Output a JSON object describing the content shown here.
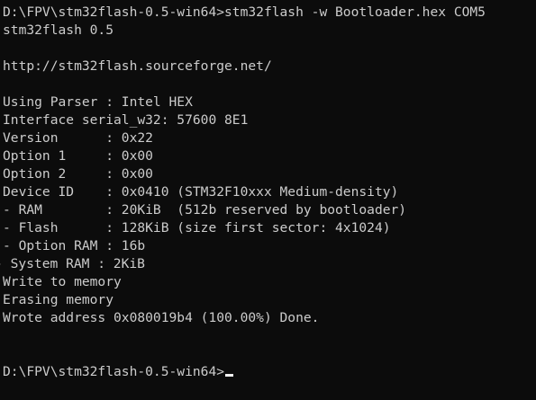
{
  "console": {
    "prompt": "D:\\FPV\\stm32flash-0.5-win64>",
    "command": "stm32flash -w Bootloader.hex COM5",
    "output": [
      "stm32flash 0.5",
      "",
      "http://stm32flash.sourceforge.net/",
      "",
      "Using Parser : Intel HEX",
      "Interface serial_w32: 57600 8E1",
      "Version      : 0x22",
      "Option 1     : 0x00",
      "Option 2     : 0x00",
      "Device ID    : 0x0410 (STM32F10xxx Medium-density)",
      "- RAM        : 20KiB  (512b reserved by bootloader)",
      "- Flash      : 128KiB (size first sector: 4x1024)",
      "- Option RAM : 16b",
      "- System RAM : 2KiB",
      "Write to memory",
      "Erasing memory",
      "Wrote address 0x080019b4 (100.00%) Done.",
      "",
      ""
    ],
    "final_prompt": "D:\\FPV\\stm32flash-0.5-win64>"
  }
}
